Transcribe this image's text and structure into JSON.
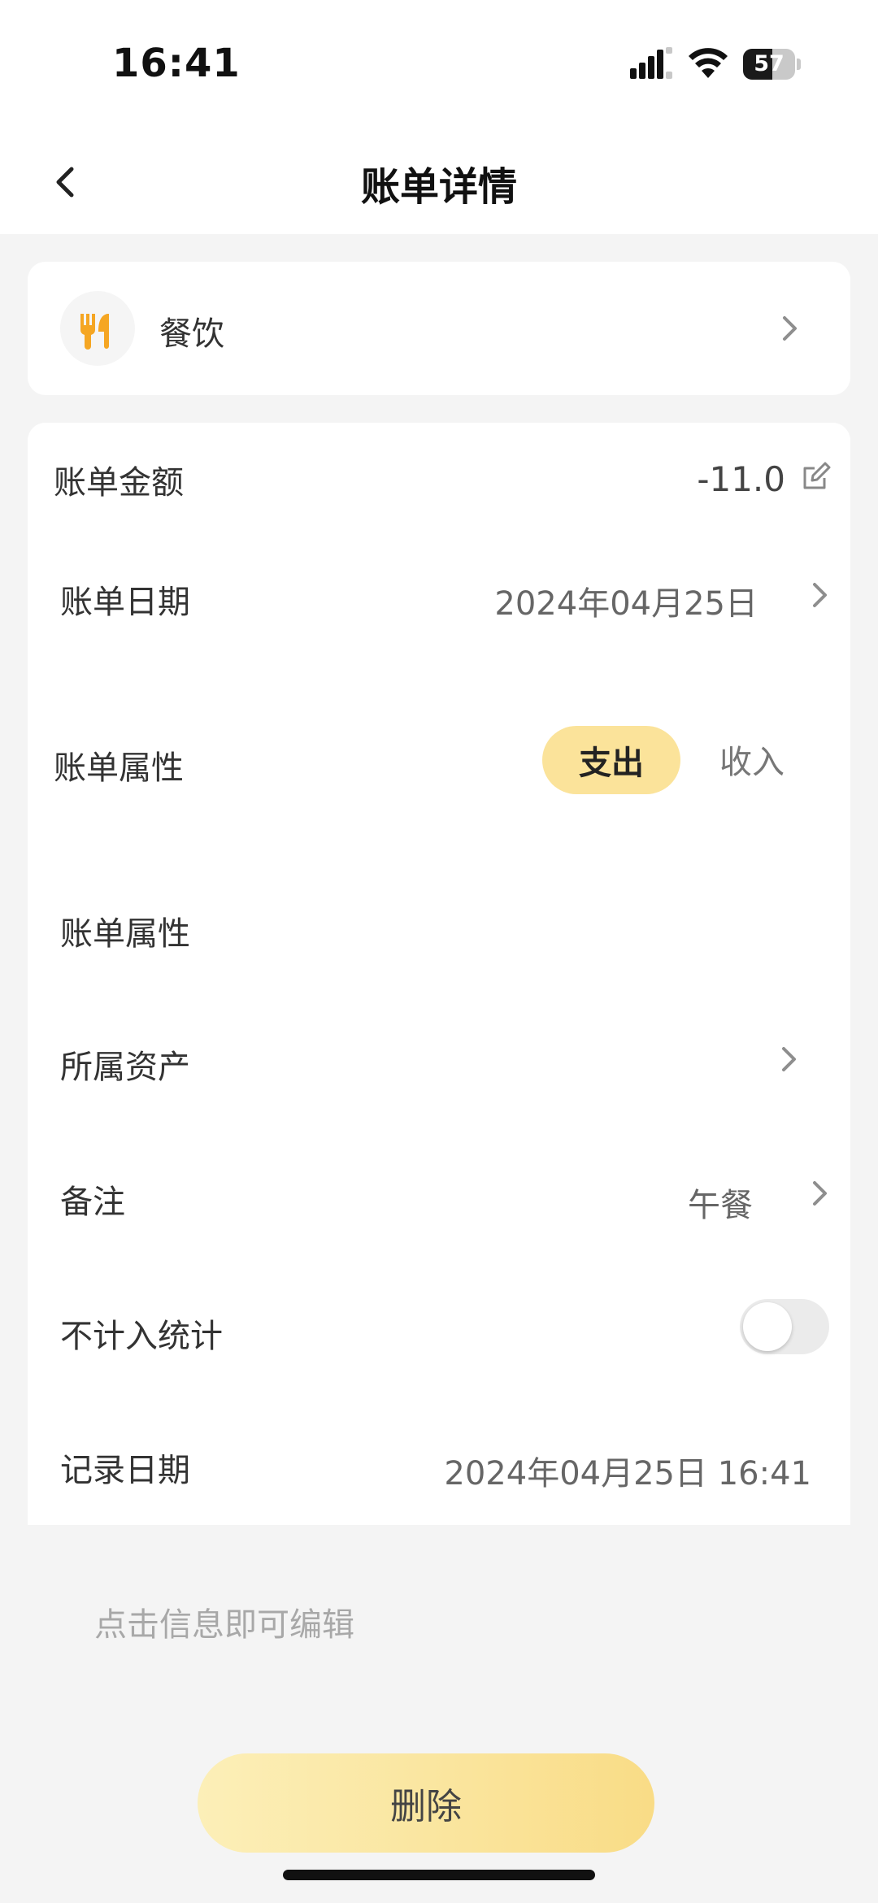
{
  "status_bar": {
    "time": "16:41",
    "battery": "57",
    "battery_level": 0.57
  },
  "nav": {
    "title": "账单详情",
    "back_icon": "chevron-left-icon"
  },
  "category": {
    "label": "餐饮",
    "icon": "utensils-icon"
  },
  "detail": {
    "amount": {
      "label": "账单金额",
      "value": "-11.0",
      "icon": "edit-icon"
    },
    "date": {
      "label": "账单日期",
      "value": "2024年04月25日"
    },
    "type": {
      "label": "账单属性",
      "options": [
        "支出",
        "收入"
      ],
      "selected": "支出"
    },
    "attribute": {
      "label": "账单属性"
    },
    "asset": {
      "label": "所属资产"
    },
    "note": {
      "label": "备注",
      "value": "午餐"
    },
    "exclude_stats": {
      "label": "不计入统计",
      "enabled": false
    },
    "record_date": {
      "label": "记录日期",
      "value": "2024年04月25日 16:41"
    }
  },
  "hint": "点击信息即可编辑",
  "delete_label": "删除",
  "colors": {
    "accent": "#fbe39a",
    "icon": "#f5a623",
    "background": "#f4f4f4"
  }
}
